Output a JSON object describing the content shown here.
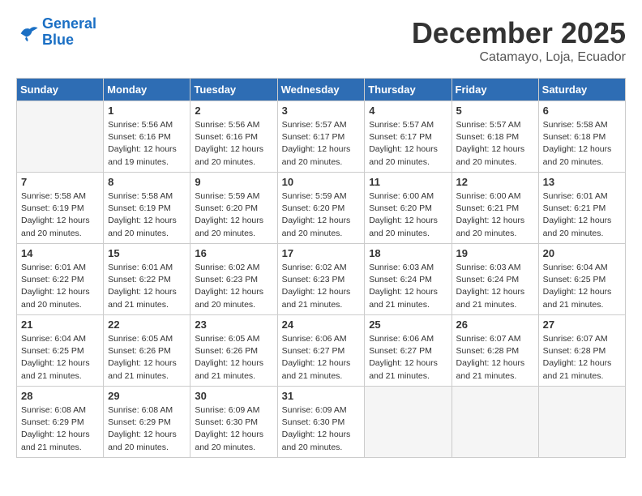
{
  "header": {
    "logo_line1": "General",
    "logo_line2": "Blue",
    "month": "December 2025",
    "location": "Catamayo, Loja, Ecuador"
  },
  "weekdays": [
    "Sunday",
    "Monday",
    "Tuesday",
    "Wednesday",
    "Thursday",
    "Friday",
    "Saturday"
  ],
  "weeks": [
    [
      {
        "day": "",
        "empty": true
      },
      {
        "day": "1",
        "sunrise": "5:56 AM",
        "sunset": "6:16 PM",
        "daylight": "12 hours and 19 minutes."
      },
      {
        "day": "2",
        "sunrise": "5:56 AM",
        "sunset": "6:16 PM",
        "daylight": "12 hours and 20 minutes."
      },
      {
        "day": "3",
        "sunrise": "5:57 AM",
        "sunset": "6:17 PM",
        "daylight": "12 hours and 20 minutes."
      },
      {
        "day": "4",
        "sunrise": "5:57 AM",
        "sunset": "6:17 PM",
        "daylight": "12 hours and 20 minutes."
      },
      {
        "day": "5",
        "sunrise": "5:57 AM",
        "sunset": "6:18 PM",
        "daylight": "12 hours and 20 minutes."
      },
      {
        "day": "6",
        "sunrise": "5:58 AM",
        "sunset": "6:18 PM",
        "daylight": "12 hours and 20 minutes."
      }
    ],
    [
      {
        "day": "7",
        "sunrise": "5:58 AM",
        "sunset": "6:19 PM",
        "daylight": "12 hours and 20 minutes."
      },
      {
        "day": "8",
        "sunrise": "5:58 AM",
        "sunset": "6:19 PM",
        "daylight": "12 hours and 20 minutes."
      },
      {
        "day": "9",
        "sunrise": "5:59 AM",
        "sunset": "6:20 PM",
        "daylight": "12 hours and 20 minutes."
      },
      {
        "day": "10",
        "sunrise": "5:59 AM",
        "sunset": "6:20 PM",
        "daylight": "12 hours and 20 minutes."
      },
      {
        "day": "11",
        "sunrise": "6:00 AM",
        "sunset": "6:20 PM",
        "daylight": "12 hours and 20 minutes."
      },
      {
        "day": "12",
        "sunrise": "6:00 AM",
        "sunset": "6:21 PM",
        "daylight": "12 hours and 20 minutes."
      },
      {
        "day": "13",
        "sunrise": "6:01 AM",
        "sunset": "6:21 PM",
        "daylight": "12 hours and 20 minutes."
      }
    ],
    [
      {
        "day": "14",
        "sunrise": "6:01 AM",
        "sunset": "6:22 PM",
        "daylight": "12 hours and 20 minutes."
      },
      {
        "day": "15",
        "sunrise": "6:01 AM",
        "sunset": "6:22 PM",
        "daylight": "12 hours and 21 minutes."
      },
      {
        "day": "16",
        "sunrise": "6:02 AM",
        "sunset": "6:23 PM",
        "daylight": "12 hours and 20 minutes."
      },
      {
        "day": "17",
        "sunrise": "6:02 AM",
        "sunset": "6:23 PM",
        "daylight": "12 hours and 21 minutes."
      },
      {
        "day": "18",
        "sunrise": "6:03 AM",
        "sunset": "6:24 PM",
        "daylight": "12 hours and 21 minutes."
      },
      {
        "day": "19",
        "sunrise": "6:03 AM",
        "sunset": "6:24 PM",
        "daylight": "12 hours and 21 minutes."
      },
      {
        "day": "20",
        "sunrise": "6:04 AM",
        "sunset": "6:25 PM",
        "daylight": "12 hours and 21 minutes."
      }
    ],
    [
      {
        "day": "21",
        "sunrise": "6:04 AM",
        "sunset": "6:25 PM",
        "daylight": "12 hours and 21 minutes."
      },
      {
        "day": "22",
        "sunrise": "6:05 AM",
        "sunset": "6:26 PM",
        "daylight": "12 hours and 21 minutes."
      },
      {
        "day": "23",
        "sunrise": "6:05 AM",
        "sunset": "6:26 PM",
        "daylight": "12 hours and 21 minutes."
      },
      {
        "day": "24",
        "sunrise": "6:06 AM",
        "sunset": "6:27 PM",
        "daylight": "12 hours and 21 minutes."
      },
      {
        "day": "25",
        "sunrise": "6:06 AM",
        "sunset": "6:27 PM",
        "daylight": "12 hours and 21 minutes."
      },
      {
        "day": "26",
        "sunrise": "6:07 AM",
        "sunset": "6:28 PM",
        "daylight": "12 hours and 21 minutes."
      },
      {
        "day": "27",
        "sunrise": "6:07 AM",
        "sunset": "6:28 PM",
        "daylight": "12 hours and 21 minutes."
      }
    ],
    [
      {
        "day": "28",
        "sunrise": "6:08 AM",
        "sunset": "6:29 PM",
        "daylight": "12 hours and 21 minutes."
      },
      {
        "day": "29",
        "sunrise": "6:08 AM",
        "sunset": "6:29 PM",
        "daylight": "12 hours and 20 minutes."
      },
      {
        "day": "30",
        "sunrise": "6:09 AM",
        "sunset": "6:30 PM",
        "daylight": "12 hours and 20 minutes."
      },
      {
        "day": "31",
        "sunrise": "6:09 AM",
        "sunset": "6:30 PM",
        "daylight": "12 hours and 20 minutes."
      },
      {
        "day": "",
        "empty": true
      },
      {
        "day": "",
        "empty": true
      },
      {
        "day": "",
        "empty": true
      }
    ]
  ]
}
